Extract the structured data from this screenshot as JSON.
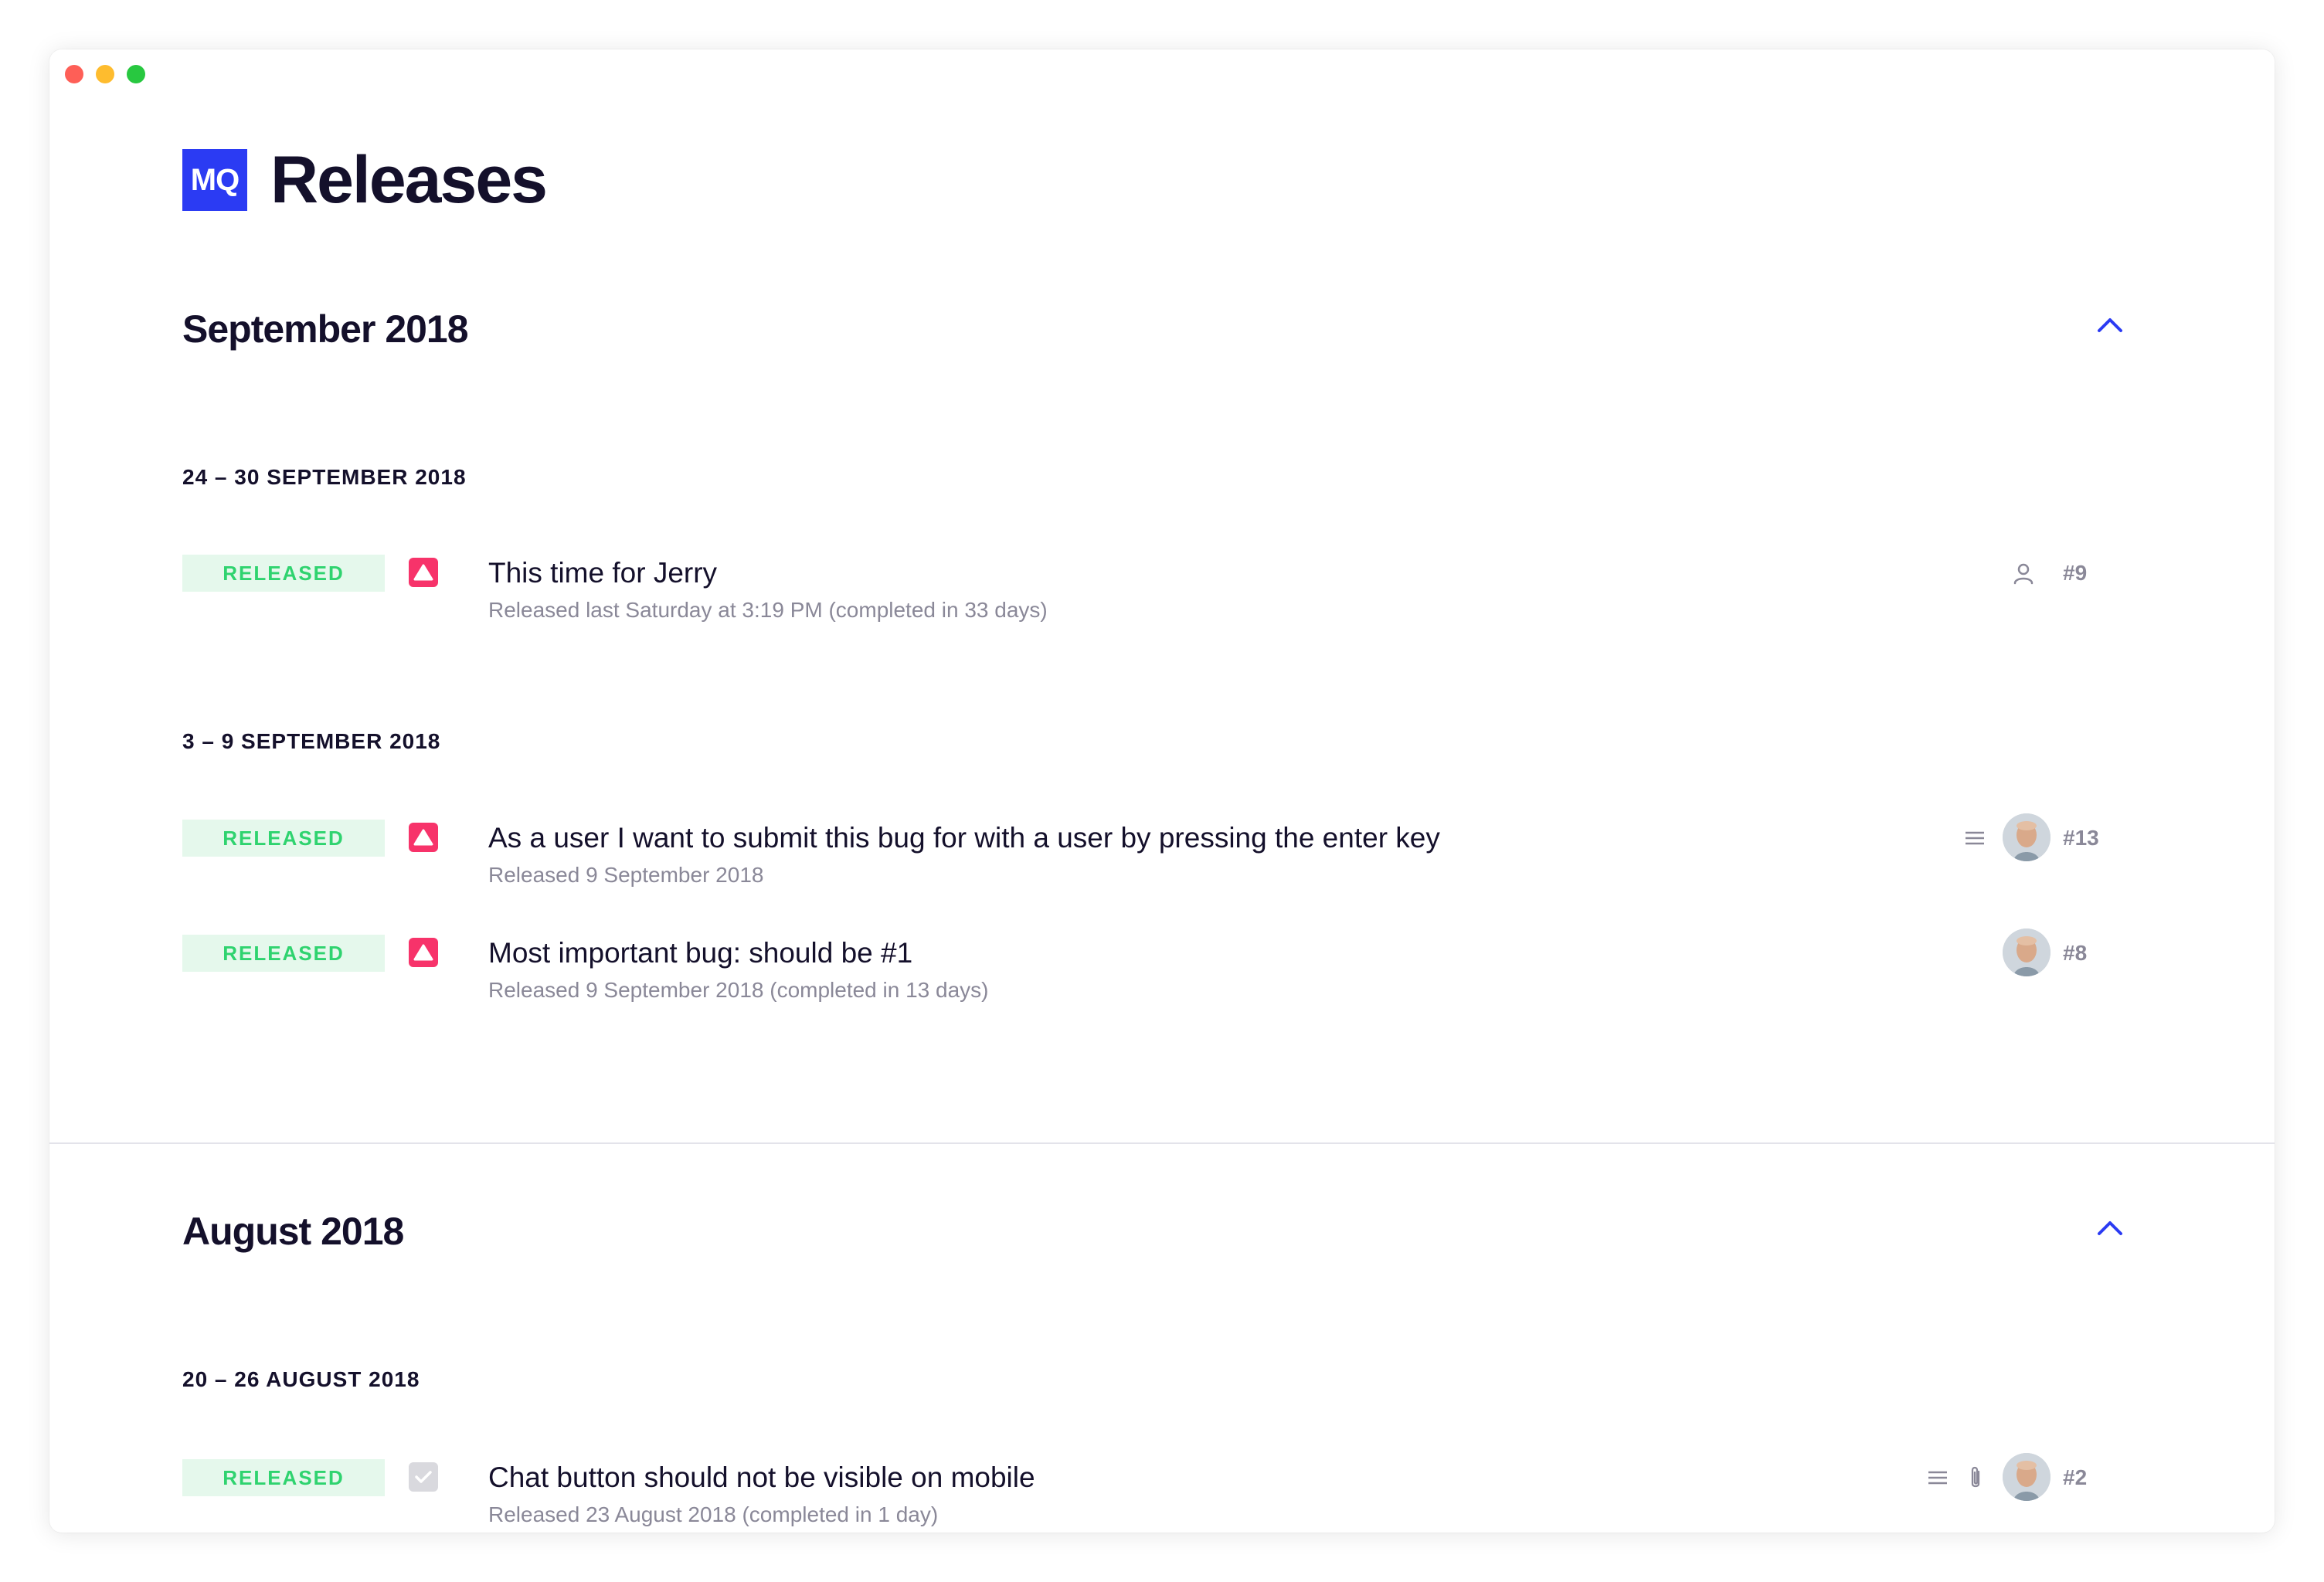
{
  "app": {
    "logo_text": "MQ",
    "title": "Releases"
  },
  "colors": {
    "accent": "#2b3bf3",
    "released_text": "#2fd36f",
    "released_bg": "#e5f8ec",
    "bug": "#f7336a",
    "muted": "#8a8898"
  },
  "months": [
    {
      "title": "September 2018",
      "collapse_icon": "chevron-up-icon",
      "weeks": [
        {
          "title": "24 – 30 SEPTEMBER 2018",
          "items": [
            {
              "status": "RELEASED",
              "type_icon": "bug-icon",
              "title": "This time for Jerry",
              "subtitle": "Released last Saturday at 3:19 PM (completed in 33 days)",
              "meta_icons": [
                "user-icon"
              ],
              "number": "#9"
            }
          ]
        },
        {
          "title": "3 – 9 SEPTEMBER 2018",
          "items": [
            {
              "status": "RELEASED",
              "type_icon": "bug-icon",
              "title": "As a user I want to submit this bug for with a user by pressing the enter key",
              "subtitle": "Released 9 September 2018",
              "meta_icons": [
                "description-icon",
                "avatar"
              ],
              "number": "#13"
            },
            {
              "status": "RELEASED",
              "type_icon": "bug-icon",
              "title": "Most important bug: should be #1",
              "subtitle": "Released 9 September 2018 (completed in 13 days)",
              "meta_icons": [
                "avatar"
              ],
              "number": "#8"
            }
          ]
        }
      ]
    },
    {
      "title": "August 2018",
      "collapse_icon": "chevron-up-icon",
      "weeks": [
        {
          "title": "20 – 26 AUGUST 2018",
          "items": [
            {
              "status": "RELEASED",
              "type_icon": "task-check-icon",
              "title": "Chat button should not be visible on mobile",
              "subtitle": "Released 23 August 2018 (completed in 1 day)",
              "meta_icons": [
                "description-icon",
                "attachment-icon",
                "avatar"
              ],
              "number": "#2"
            }
          ]
        }
      ]
    }
  ]
}
